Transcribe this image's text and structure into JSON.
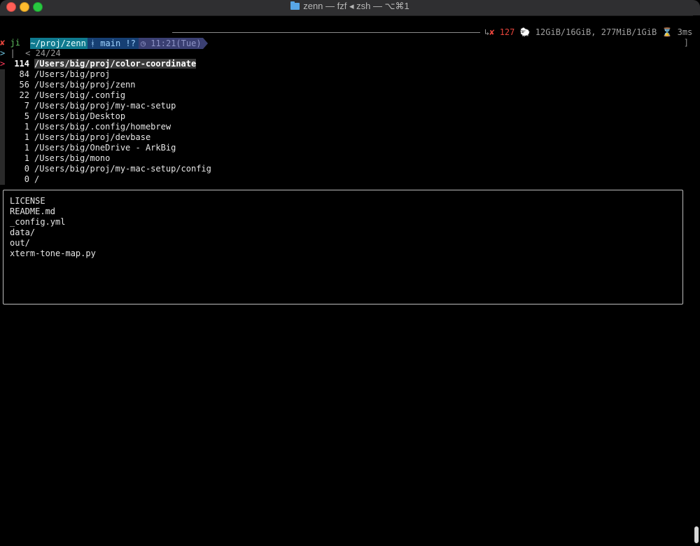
{
  "window": {
    "title": "zenn — fzf ◂ zsh — ⌥⌘1",
    "icon": "folder-icon"
  },
  "prompt": {
    "dir": "~/proj/zenn",
    "git_branch": " main !?",
    "git_icon": "branch-icon",
    "time": "◷ 11:21(Tue)",
    "right": {
      "return_symbol": "↳",
      "error_symbol": "✘",
      "exit_code": "127",
      "sheep_icon": "🐑",
      "memory": " 12GiB/16GiB, 277MiB/1GiB",
      "duration": "⌛ 3ms↵"
    }
  },
  "command": {
    "error_mark": "✘",
    "text": "ji"
  },
  "fzf": {
    "prompt": ">",
    "cursor": "|",
    "info": "< 24/24",
    "pointer": ">",
    "items": [
      {
        "count": "114",
        "path": "/Users/big/proj/color-coordinate",
        "selected": true
      },
      {
        "count": "84",
        "path": "/Users/big/proj"
      },
      {
        "count": "56",
        "path": "/Users/big/proj/zenn"
      },
      {
        "count": "22",
        "path": "/Users/big/.config"
      },
      {
        "count": "7",
        "path": "/Users/big/proj/my-mac-setup"
      },
      {
        "count": "5",
        "path": "/Users/big/Desktop"
      },
      {
        "count": "1",
        "path": "/Users/big/.config/homebrew"
      },
      {
        "count": "1",
        "path": "/Users/big/proj/devbase"
      },
      {
        "count": "1",
        "path": "/Users/big/OneDrive - ArkBig"
      },
      {
        "count": "1",
        "path": "/Users/big/mono"
      },
      {
        "count": "0",
        "path": "/Users/big/proj/my-mac-setup/config"
      },
      {
        "count": "0",
        "path": "/"
      }
    ]
  },
  "preview": {
    "files": [
      "LICENSE",
      "README.md",
      "_config.yml",
      "data/",
      "out/",
      "xterm-tone-map.py"
    ]
  },
  "scroll_bracket": "]"
}
